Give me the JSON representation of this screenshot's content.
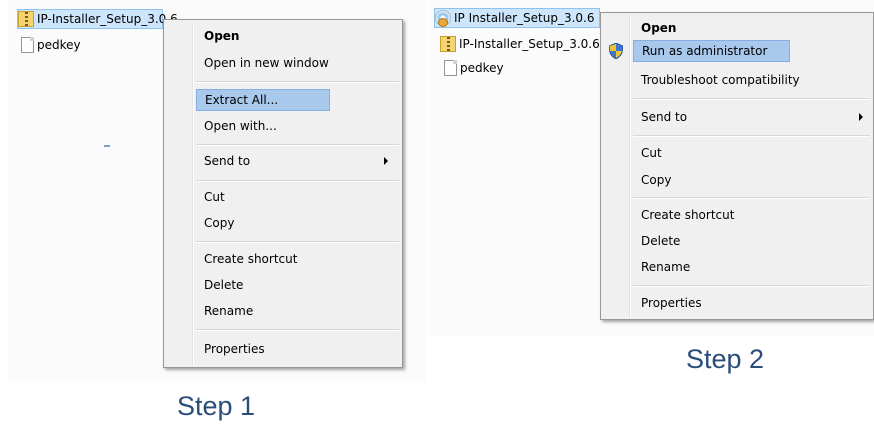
{
  "step1": {
    "files": [
      {
        "label": "IP-Installer_Setup_3.0.6",
        "icon": "zip-folder-icon",
        "selected": true
      },
      {
        "label": "pedkey",
        "icon": "document-icon",
        "selected": false
      }
    ],
    "menu": {
      "items": [
        {
          "label": "Open",
          "bold": true
        },
        {
          "label": "Open in new window"
        },
        {
          "label": "Extract All...",
          "highlighted": true
        },
        {
          "label": "Open with..."
        },
        {
          "label": "Send to",
          "submenu": true
        },
        {
          "label": "Cut"
        },
        {
          "label": "Copy"
        },
        {
          "label": "Create shortcut"
        },
        {
          "label": "Delete"
        },
        {
          "label": "Rename"
        },
        {
          "label": "Properties"
        }
      ]
    },
    "caption": "Step 1"
  },
  "step2": {
    "files": [
      {
        "label": "IP Installer_Setup_3.0.6",
        "icon": "setup-disc-icon",
        "selected": true
      },
      {
        "label": "IP-Installer_Setup_3.0.6",
        "icon": "zip-folder-icon",
        "selected": false
      },
      {
        "label": "pedkey",
        "icon": "document-icon",
        "selected": false
      }
    ],
    "menu": {
      "items": [
        {
          "label": "Open",
          "bold": true
        },
        {
          "label": "Run as administrator",
          "highlighted": true,
          "icon": "uac-shield-icon"
        },
        {
          "label": "Troubleshoot compatibility"
        },
        {
          "label": "Send to",
          "submenu": true
        },
        {
          "label": "Cut"
        },
        {
          "label": "Copy"
        },
        {
          "label": "Create shortcut"
        },
        {
          "label": "Delete"
        },
        {
          "label": "Rename"
        },
        {
          "label": "Properties"
        }
      ]
    },
    "caption": "Step 2"
  },
  "colors": {
    "highlight": "#a8c8ec",
    "caption": "#2a4d7a",
    "menu_bg": "#f0f0f0"
  }
}
